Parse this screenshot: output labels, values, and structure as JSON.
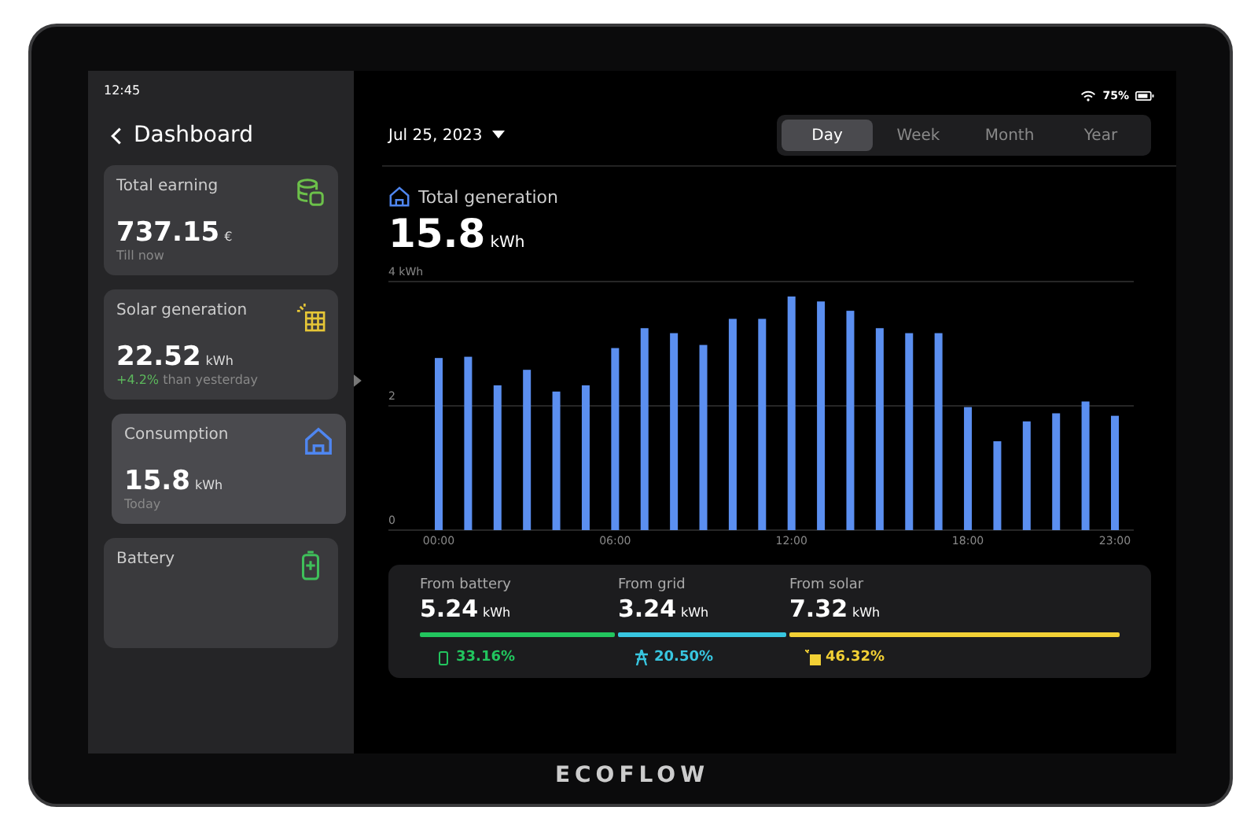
{
  "status_bar": {
    "time": "12:45",
    "battery": "75%"
  },
  "sidebar": {
    "title": "Dashboard",
    "cards": [
      {
        "kind": "earning",
        "title": "Total earning",
        "value": "737.15",
        "unit": "€",
        "note": "Till now",
        "selected": false
      },
      {
        "kind": "solar",
        "title": "Solar generation",
        "value": "22.52",
        "unit": "kWh",
        "change": "+4.2%",
        "note": " than yesterday",
        "selected": false
      },
      {
        "kind": "home",
        "title": "Consumption",
        "value": "15.8",
        "unit": "kWh",
        "note": "Today",
        "selected": true
      },
      {
        "kind": "battery",
        "title": "Battery",
        "selected": false
      }
    ]
  },
  "date_picker": {
    "value": "Jul 25, 2023"
  },
  "tabs": [
    {
      "label": "Day",
      "selected": true
    },
    {
      "label": "Week",
      "selected": false
    },
    {
      "label": "Month",
      "selected": false
    },
    {
      "label": "Year",
      "selected": false
    }
  ],
  "summary": {
    "title": "Total generation",
    "value": "15.8",
    "unit": "kWh"
  },
  "chart_data": {
    "type": "bar",
    "x": [
      0,
      1,
      2,
      3,
      4,
      5,
      6,
      7,
      8,
      9,
      10,
      11,
      12,
      13,
      14,
      15,
      16,
      17,
      18,
      19,
      20,
      21,
      22,
      23
    ],
    "series": [
      {
        "color": "#5b8ff0",
        "values": [
          2.77,
          2.79,
          2.33,
          2.58,
          2.23,
          2.33,
          2.93,
          3.25,
          3.17,
          2.98,
          3.4,
          3.4,
          3.76,
          3.68,
          3.53,
          3.25,
          3.17,
          3.17,
          1.98,
          1.43,
          1.75,
          1.88,
          2.07,
          1.84
        ]
      }
    ],
    "ylim": [
      0,
      4
    ],
    "yticks": [
      0,
      2,
      {
        "value": 4,
        "label": "4 kWh"
      }
    ],
    "xlim": [
      0,
      23
    ],
    "xticks": [
      {
        "value": 0,
        "label": "00:00"
      },
      {
        "value": 6,
        "label": "06:00"
      },
      {
        "value": 12,
        "label": "12:00"
      },
      {
        "value": 18,
        "label": "18:00"
      },
      {
        "value": 23,
        "label": "23:00"
      }
    ]
  },
  "sources": [
    {
      "kind": "battery",
      "label": "From battery",
      "value": "5.24",
      "unit": "kWh",
      "share": "33.16%",
      "color": "#22c55e"
    },
    {
      "kind": "grid",
      "label": "From grid",
      "value": "3.24",
      "unit": "kWh",
      "share": "20.50%",
      "color": "#38c6e0"
    },
    {
      "kind": "solar",
      "label": "From solar",
      "value": "7.32",
      "unit": "kWh",
      "share": "46.32%",
      "color": "#f2d035"
    }
  ],
  "brand": "ECOFLOW"
}
